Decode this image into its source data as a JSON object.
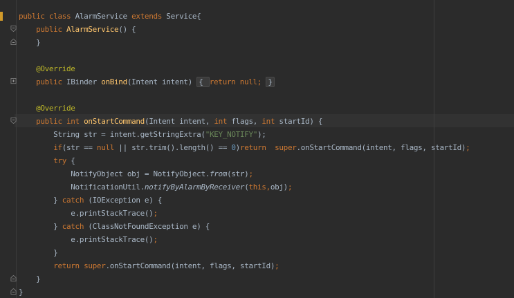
{
  "editor": {
    "lines": [
      {
        "tokens": [
          {
            "t": "public ",
            "k": "kw"
          },
          {
            "t": "class ",
            "k": "kw"
          },
          {
            "t": "AlarmService ",
            "k": "typ"
          },
          {
            "t": "extends ",
            "k": "kw"
          },
          {
            "t": "Service{",
            "k": "typ"
          }
        ]
      },
      {
        "tokens": [
          {
            "t": "    "
          },
          {
            "t": "public ",
            "k": "kw"
          },
          {
            "t": "AlarmService",
            "k": "cls"
          },
          {
            "t": "() {"
          }
        ]
      },
      {
        "tokens": [
          {
            "t": "    }"
          }
        ]
      },
      {
        "tokens": []
      },
      {
        "tokens": [
          {
            "t": "    "
          },
          {
            "t": "@Override",
            "k": "ann"
          }
        ]
      },
      {
        "tokens": [
          {
            "t": "    "
          },
          {
            "t": "public ",
            "k": "kw"
          },
          {
            "t": "IBinder "
          },
          {
            "t": "onBind",
            "k": "mth"
          },
          {
            "t": "(Intent intent) "
          },
          {
            "t": "{ ",
            "k": "fold"
          },
          {
            "t": "return ",
            "k": "kw"
          },
          {
            "t": "null",
            "k": "kw"
          },
          {
            "t": "; ",
            "k": "kw"
          },
          {
            "t": "}",
            "k": "fold"
          }
        ]
      },
      {
        "tokens": []
      },
      {
        "tokens": [
          {
            "t": "    "
          },
          {
            "t": "@Override",
            "k": "ann"
          }
        ]
      },
      {
        "tokens": [
          {
            "t": "    "
          },
          {
            "t": "public ",
            "k": "kw"
          },
          {
            "t": "int ",
            "k": "kw"
          },
          {
            "t": "onStartCommand",
            "k": "mth"
          },
          {
            "t": "(Intent intent, "
          },
          {
            "t": "int ",
            "k": "kw"
          },
          {
            "t": "flags, "
          },
          {
            "t": "int ",
            "k": "kw"
          },
          {
            "t": "startId) {"
          }
        ]
      },
      {
        "tokens": [
          {
            "t": "        String str = intent.getStringExtra("
          },
          {
            "t": "\"KEY_NOTIFY\"",
            "k": "str"
          },
          {
            "t": ");"
          }
        ]
      },
      {
        "tokens": [
          {
            "t": "        "
          },
          {
            "t": "if",
            "k": "kw"
          },
          {
            "t": "(str == "
          },
          {
            "t": "null ",
            "k": "kw"
          },
          {
            "t": "|| str.trim().length() == "
          },
          {
            "t": "0",
            "k": "num"
          },
          {
            "t": ")"
          },
          {
            "t": "return  ",
            "k": "kw"
          },
          {
            "t": "super",
            "k": "kw"
          },
          {
            "t": ".onStartCommand(intent, flags, startId)"
          },
          {
            "t": ";",
            "k": "kw"
          }
        ]
      },
      {
        "tokens": [
          {
            "t": "        "
          },
          {
            "t": "try ",
            "k": "kw"
          },
          {
            "t": "{"
          }
        ]
      },
      {
        "tokens": [
          {
            "t": "            NotifyObject obj = NotifyObject."
          },
          {
            "t": "from",
            "k": "it"
          },
          {
            "t": "(str)"
          },
          {
            "t": ";",
            "k": "kw"
          }
        ]
      },
      {
        "tokens": [
          {
            "t": "            NotificationUtil."
          },
          {
            "t": "notifyByAlarmByReceiver",
            "k": "it"
          },
          {
            "t": "("
          },
          {
            "t": "this",
            "k": "kw"
          },
          {
            "t": ",",
            "k": "kw"
          },
          {
            "t": "obj)"
          },
          {
            "t": ";",
            "k": "kw"
          }
        ]
      },
      {
        "tokens": [
          {
            "t": "        } "
          },
          {
            "t": "catch ",
            "k": "kw"
          },
          {
            "t": "(IOException e) {"
          }
        ]
      },
      {
        "tokens": [
          {
            "t": "            e.printStackTrace()"
          },
          {
            "t": ";",
            "k": "kw"
          }
        ]
      },
      {
        "tokens": [
          {
            "t": "        } "
          },
          {
            "t": "catch ",
            "k": "kw"
          },
          {
            "t": "(ClassNotFoundException e) {"
          }
        ]
      },
      {
        "tokens": [
          {
            "t": "            e.printStackTrace()"
          },
          {
            "t": ";",
            "k": "kw"
          }
        ]
      },
      {
        "tokens": [
          {
            "t": "        }"
          }
        ]
      },
      {
        "tokens": [
          {
            "t": "        "
          },
          {
            "t": "return ",
            "k": "kw"
          },
          {
            "t": "super",
            "k": "kw"
          },
          {
            "t": ".onStartCommand(intent, flags, startId)"
          },
          {
            "t": ";",
            "k": "kw"
          }
        ]
      },
      {
        "tokens": [
          {
            "t": "    }"
          }
        ]
      },
      {
        "tokens": [
          {
            "t": "}"
          }
        ]
      }
    ],
    "fold_markers": [
      {
        "line": 1,
        "state": "open"
      },
      {
        "line": 2,
        "state": "end"
      },
      {
        "line": 5,
        "state": "collapsed"
      },
      {
        "line": 8,
        "state": "open"
      },
      {
        "line": 20,
        "state": "end"
      },
      {
        "line": 21,
        "state": "end"
      }
    ]
  },
  "colors": {
    "background": "#2b2b2b",
    "keyword": "#cc7832",
    "text": "#a9b7c6",
    "method_declaration": "#ffc66d",
    "annotation": "#bbb529",
    "string": "#6a8759",
    "number": "#6897bb",
    "change_marker": "#d19a2a"
  }
}
